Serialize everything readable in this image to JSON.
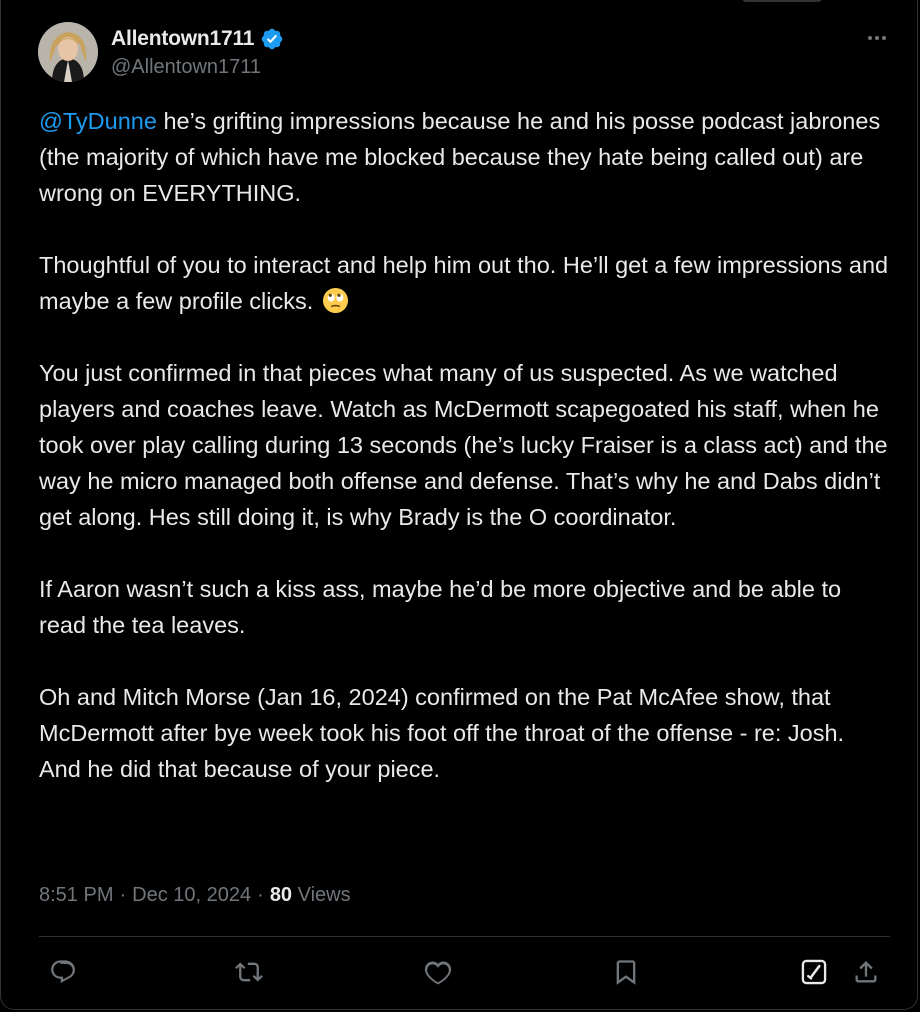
{
  "tweet": {
    "author": {
      "display_name": "Allentown1711",
      "handle": "@Allentown1711",
      "verified": true
    },
    "body": {
      "mention": "@TyDunne",
      "p1_rest": " he’s grifting impressions because he and his posse podcast jabrones (the majority of which have me blocked because they hate being called out) are wrong on EVERYTHING.",
      "p2": "Thoughtful of you to interact and help him out tho. He’ll get a few impressions and maybe a few profile clicks.",
      "p2_emoji": "face-with-rolling-eyes",
      "p3": "You just confirmed in that pieces what many of us suspected.  As we watched players and coaches leave. Watch as McDermott scapegoated his staff, when he took over play calling during 13 seconds (he’s lucky Fraiser is a class act) and the way he micro managed both offense and defense. That’s why he and Dabs didn’t get along. Hes still doing it, is why Brady is the O coordinator.",
      "p4": "If Aaron wasn’t such a kiss ass, maybe he’d be more objective and be able to read the tea leaves.",
      "p5_line1": "Oh and Mitch Morse (Jan 16, 2024) confirmed on the Pat McAfee show, that McDermott after bye week took his foot off the throat of the offense - re: Josh.",
      "p5_line2": "And he did that because of your piece."
    },
    "meta": {
      "time": "8:51 PM",
      "separator": "·",
      "date": "Dec 10, 2024",
      "views_count": "80",
      "views_label": "Views"
    },
    "actions": [
      "reply-icon",
      "retweet-icon",
      "like-icon",
      "bookmark-icon",
      "grok-icon",
      "share-icon"
    ]
  },
  "colors": {
    "background": "#000000",
    "text": "#e7e9ea",
    "secondary": "#71767b",
    "accent": "#1d9bf0",
    "border": "#2f3336"
  }
}
